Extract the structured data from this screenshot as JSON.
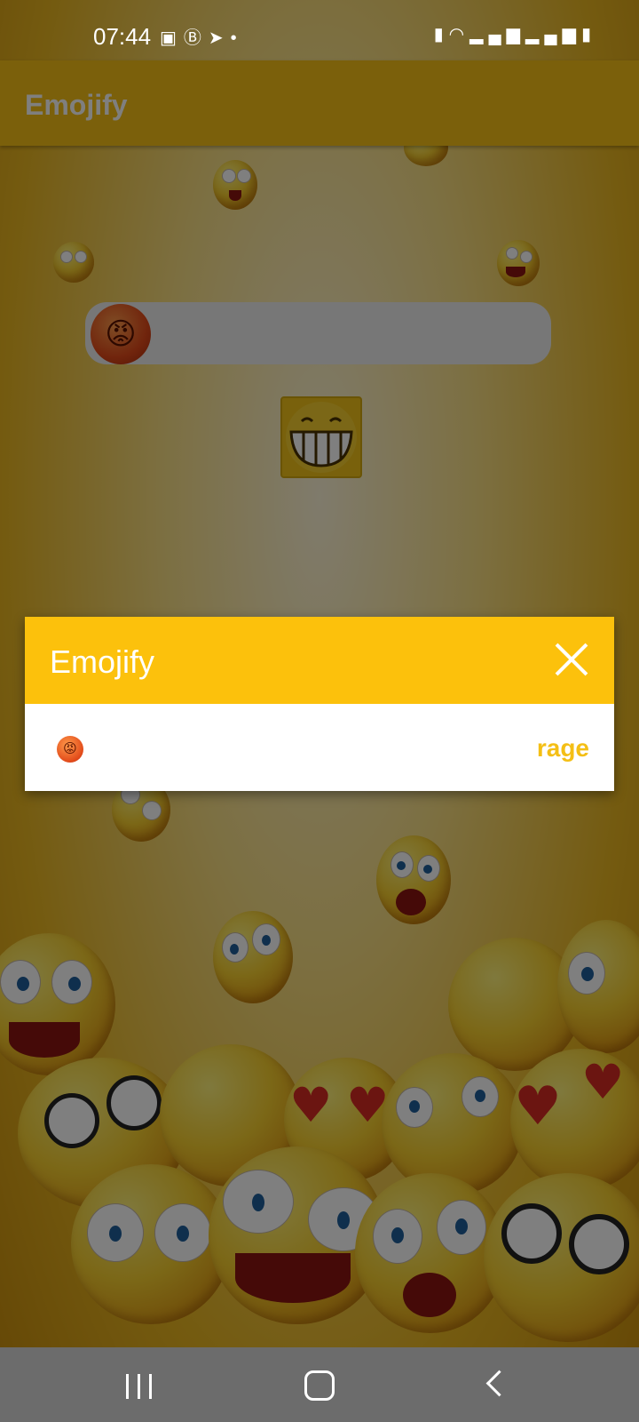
{
  "status_bar": {
    "time": "07:44",
    "left_icons": [
      "image-icon",
      "b-badge-icon",
      "telegram-icon",
      "dot-icon"
    ],
    "right_icons": [
      "battery-saver-icon",
      "wifi-icon",
      "signal-icon",
      "signal-icon",
      "battery-icon"
    ]
  },
  "app_bar": {
    "title": "Emojify"
  },
  "main": {
    "input_emoji": "😡",
    "preview_emoji_name": "grinning-face-icon"
  },
  "dialog": {
    "title": "Emojify",
    "close_icon": "close-icon",
    "row": {
      "emoji": "😡",
      "label": "rage"
    }
  },
  "colors": {
    "accent": "#fcc10c",
    "label": "#f4bf15",
    "nav_bar": "#6c6c6c"
  },
  "nav_bar": {
    "buttons": [
      "recents-icon",
      "home-icon",
      "back-icon"
    ]
  }
}
